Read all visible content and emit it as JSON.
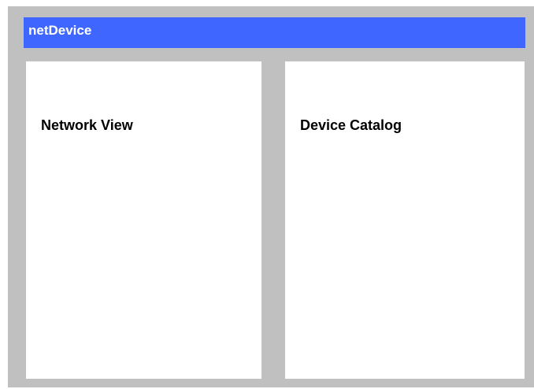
{
  "app": {
    "title": "netDevice"
  },
  "panels": {
    "network_view": {
      "title": "Network View"
    },
    "device_catalog": {
      "title": "Device Catalog"
    }
  },
  "colors": {
    "titlebar": "#3f67ff",
    "background": "#c0c0c0",
    "panel": "#ffffff"
  }
}
